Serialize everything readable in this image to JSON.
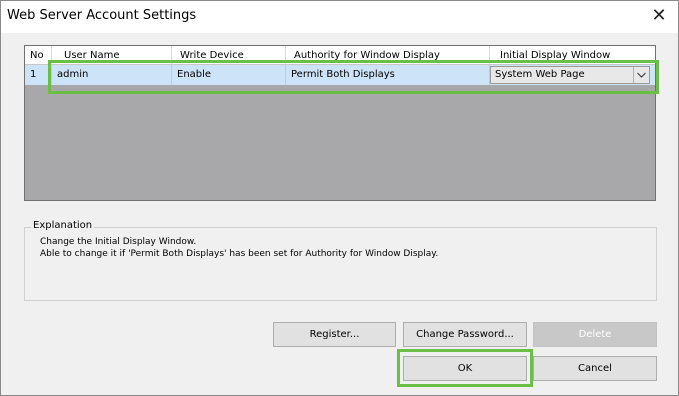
{
  "window": {
    "title": "Web Server Account Settings",
    "close_glyph": "✕"
  },
  "table": {
    "columns": [
      "No",
      "User Name",
      "Write Device",
      "Authority for Window Display",
      "Initial Display Window"
    ],
    "rows": [
      {
        "no": "1",
        "user_name": "admin",
        "write_device": "Enable",
        "authority": "Permit Both Displays",
        "initial_display_window": "System Web Page"
      }
    ]
  },
  "explanation": {
    "legend": "Explanation",
    "lines": [
      "Change the Initial Display Window.",
      "Able to change it if 'Permit Both Displays' has been set for Authority for Window Display."
    ]
  },
  "buttons": {
    "register": "Register...",
    "change_password": "Change Password...",
    "delete": "Delete",
    "ok": "OK",
    "cancel": "Cancel"
  },
  "colors": {
    "highlight": "#6abf45",
    "selection": "#cde3f7"
  }
}
